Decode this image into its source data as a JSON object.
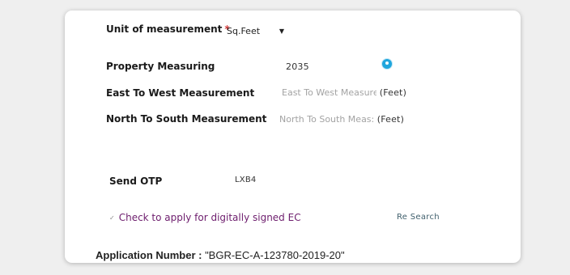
{
  "unit_row": {
    "label": "Unit of measurement",
    "required_mark": "*",
    "selected": "Sq.Feet"
  },
  "property": {
    "label": "Property Measuring",
    "value": "2035"
  },
  "east_west": {
    "label": "East To West Measurement",
    "placeholder": "East To West Measure",
    "unit": "(Feet)"
  },
  "north_south": {
    "label": "North To South Measurement",
    "placeholder": "North To South Meas:",
    "unit": "(Feet)"
  },
  "otp": {
    "label": "Send OTP",
    "value": "LXB4"
  },
  "digital_sign": {
    "check_icon": "check-icon",
    "label": "Check to apply for digitally signed EC"
  },
  "research_label": "Re Search",
  "application": {
    "key": "Application Number : ",
    "value": "\"BGR-EC-A-123780-2019-20\""
  },
  "colors": {
    "required": "#d23b3b",
    "info_icon": "#1fa6dd",
    "check_label": "#6d1d6d"
  }
}
